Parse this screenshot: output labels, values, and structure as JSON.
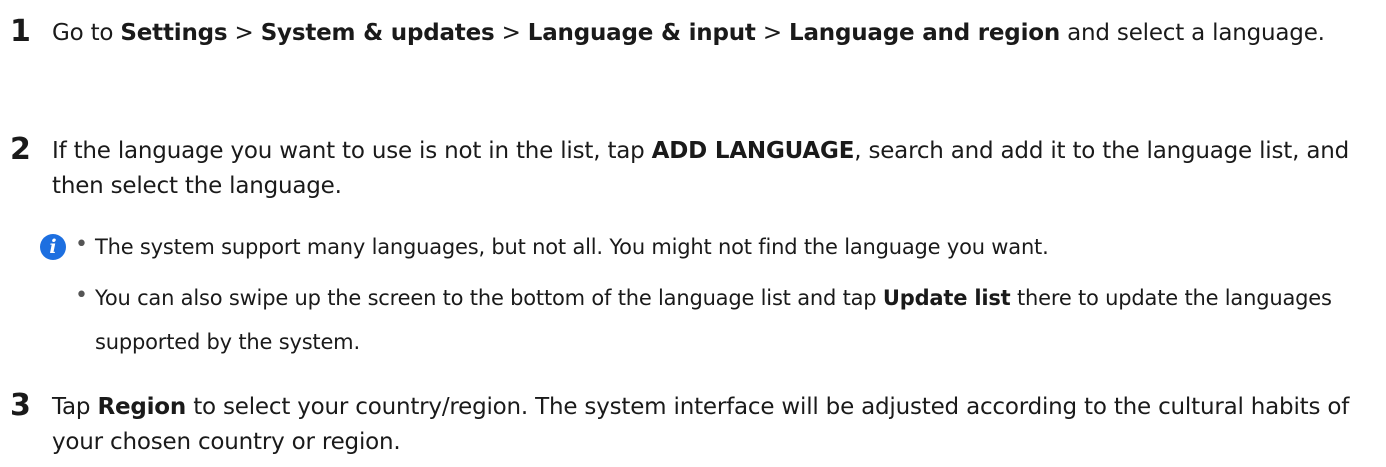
{
  "steps": [
    {
      "number": "1",
      "parts": [
        "Go to ",
        "Settings",
        " > ",
        "System & updates",
        " > ",
        "Language & input",
        " > ",
        "Language and region",
        " and select a language."
      ]
    },
    {
      "number": "2",
      "parts": [
        "If the language you want to use is not in the list, tap ",
        "ADD LANGUAGE",
        ", search and add it to the language list, and then select the language."
      ]
    },
    {
      "number": "3",
      "parts": [
        "Tap ",
        "Region",
        " to select your country/region. The system interface will be adjusted according to the cultural habits of your chosen country or region."
      ]
    }
  ],
  "note": {
    "icon": "info-icon",
    "icon_glyph": "i",
    "icon_color": "#1d6fe0",
    "bullet_glyph": "•",
    "items": [
      {
        "parts": [
          "The system support many languages, but not all. You might not find the language you want."
        ]
      },
      {
        "parts": [
          "You can also swipe up the screen to the bottom of the language list and tap ",
          "Update list",
          " there to update the languages supported by the system."
        ]
      }
    ]
  }
}
